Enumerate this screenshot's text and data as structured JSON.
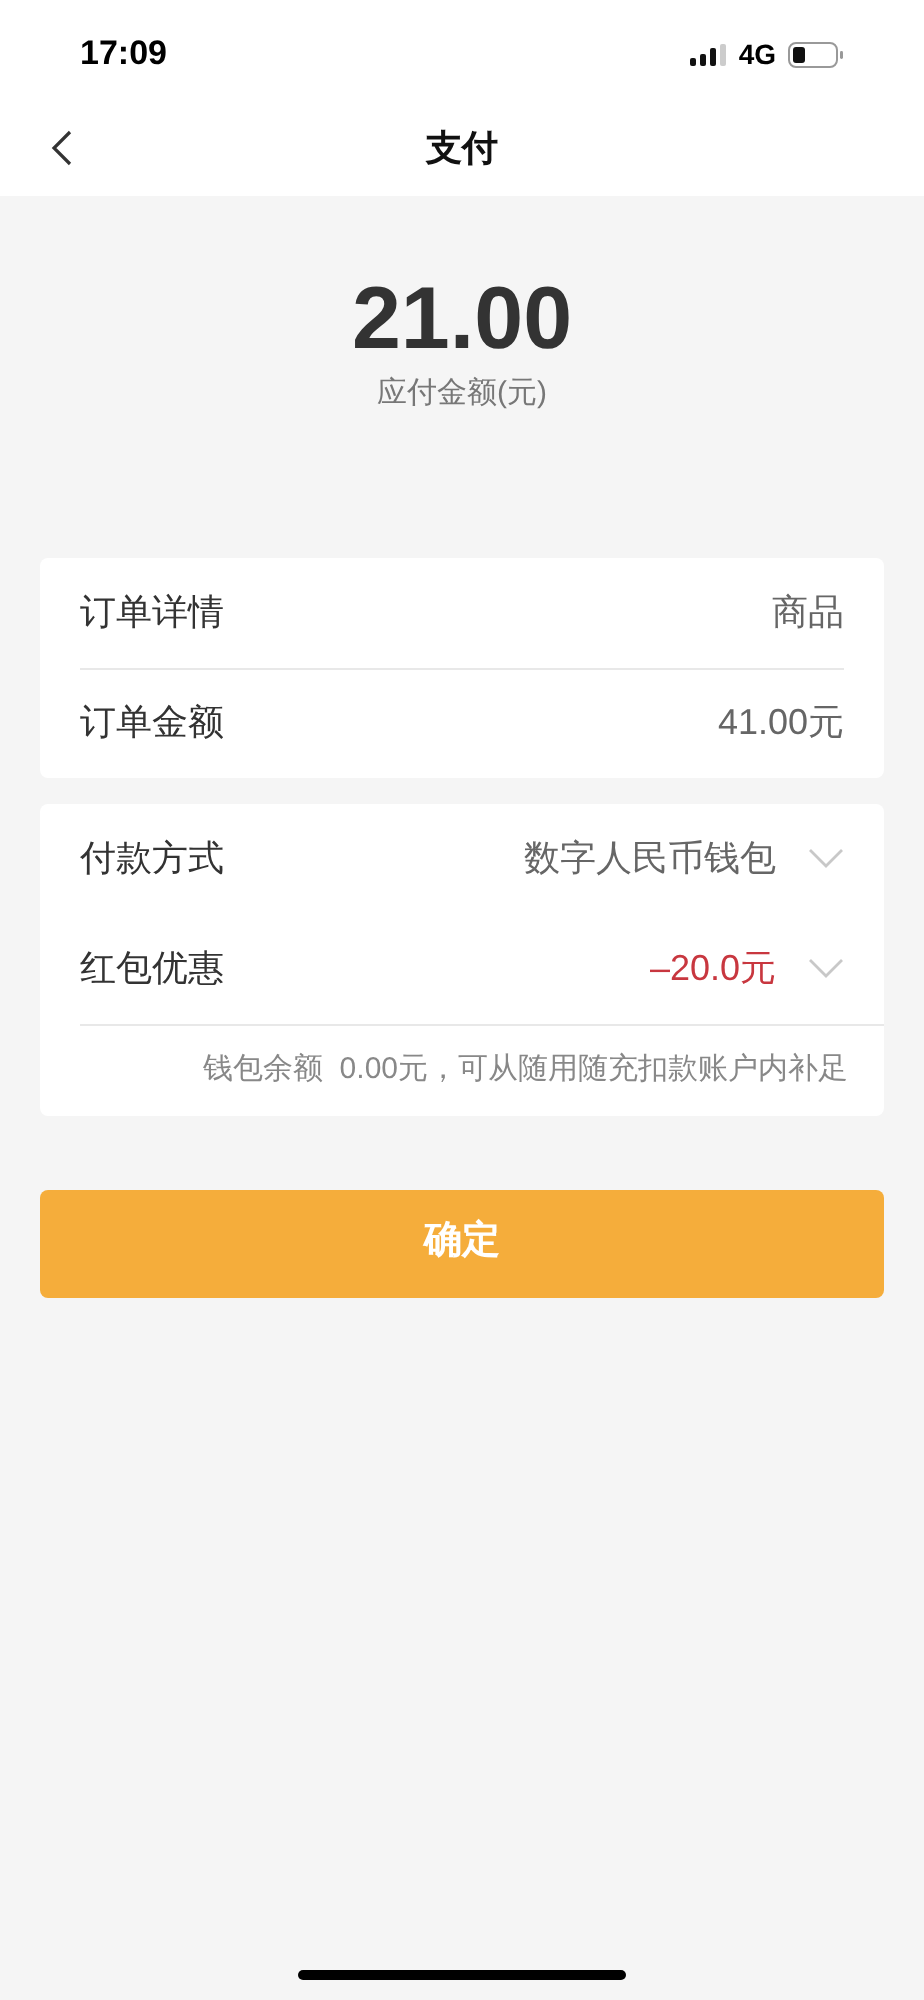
{
  "status_bar": {
    "time": "17:09",
    "network": "4G"
  },
  "nav": {
    "title": "支付"
  },
  "amount": {
    "value": "21.00",
    "label": "应付金额(元)"
  },
  "order_card": [
    {
      "label": "订单详情",
      "value": "商品"
    },
    {
      "label": "订单金额",
      "value": "41.00元"
    }
  ],
  "payment_card": {
    "rows": [
      {
        "label": "付款方式",
        "value": "数字人民币钱包",
        "negative": false
      },
      {
        "label": "红包优惠",
        "value": "–20.0元",
        "negative": true
      }
    ],
    "note": "钱包余额  0.00元，可从随用随充扣款账户内补足"
  },
  "confirm_button": "确定"
}
